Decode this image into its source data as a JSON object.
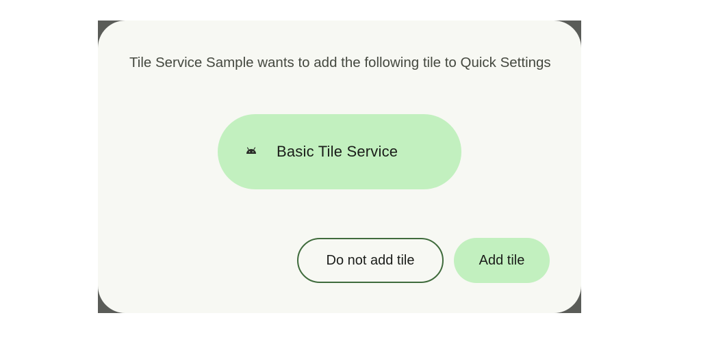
{
  "dialog": {
    "message": "Tile Service Sample wants to add the following tile to Quick Settings",
    "tile": {
      "icon": "android-robot-icon",
      "label": "Basic Tile Service"
    },
    "buttons": {
      "decline_label": "Do not add tile",
      "accept_label": "Add tile"
    }
  },
  "colors": {
    "dialog_background": "#f7f8f3",
    "accent_container": "#c2f0bf",
    "outline": "#3f6b3c",
    "text_primary": "#1a1c19",
    "text_secondary": "#44483f"
  }
}
